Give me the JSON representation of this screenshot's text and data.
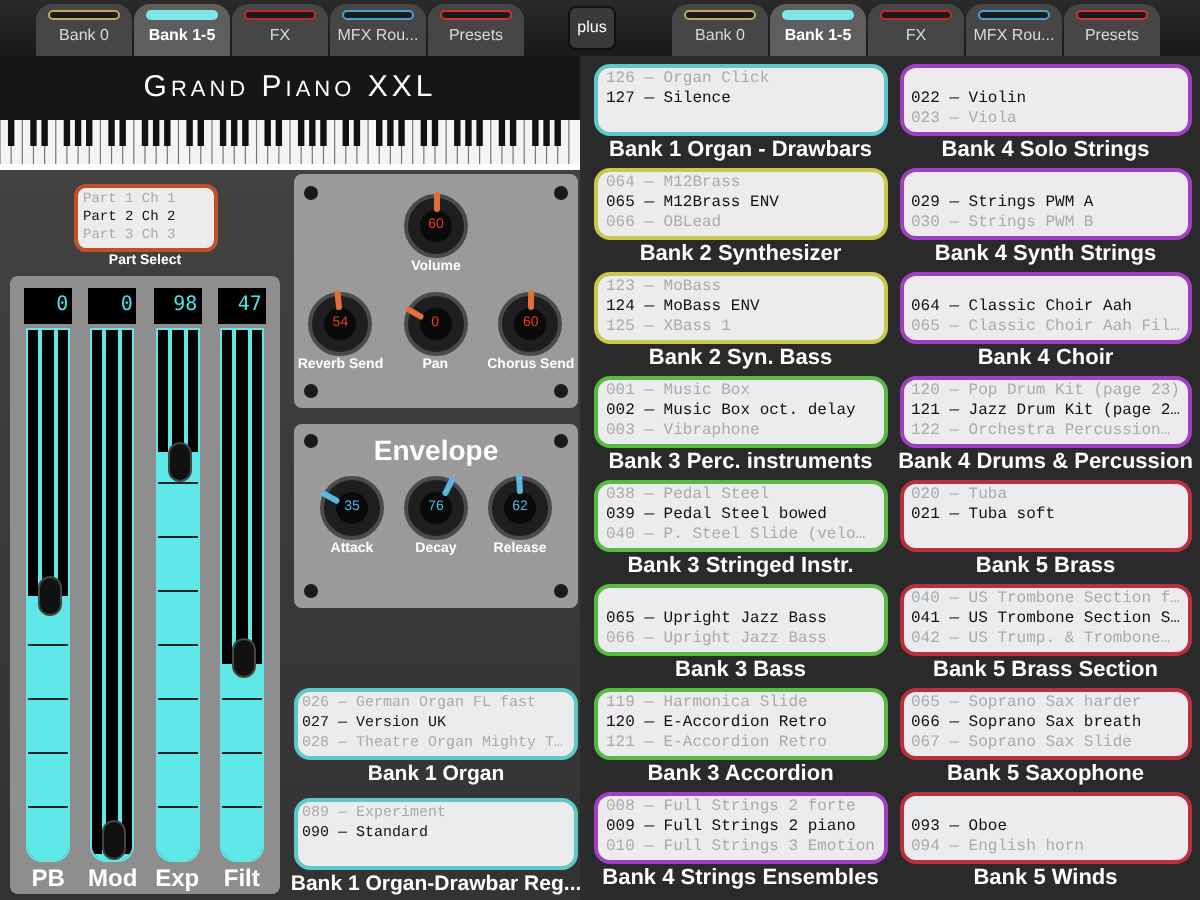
{
  "top_bar": {
    "left_tabs": [
      {
        "label": "Bank 0",
        "selected": false,
        "color": "#c8a860"
      },
      {
        "label": "Bank 1-5",
        "selected": true,
        "color": "#7fe6e6"
      },
      {
        "label": "FX",
        "selected": false,
        "color": "#c0282c"
      },
      {
        "label": "MFX Rou...",
        "selected": false,
        "color": "#4aa0d0"
      },
      {
        "label": "Presets",
        "selected": false,
        "color": "#d03030"
      }
    ],
    "plus_button": "plus",
    "right_tabs": [
      {
        "label": "Bank 0",
        "selected": false,
        "color": "#c8a860"
      },
      {
        "label": "Bank 1-5",
        "selected": true,
        "color": "#7fe6e6"
      },
      {
        "label": "FX",
        "selected": false,
        "color": "#c0282c"
      },
      {
        "label": "MFX Rou...",
        "selected": false,
        "color": "#4aa0d0"
      },
      {
        "label": "Presets",
        "selected": false,
        "color": "#d03030"
      }
    ]
  },
  "instrument": {
    "title": "Grand Piano XXL"
  },
  "part_select": {
    "label": "Part Select",
    "items": [
      {
        "text": "Part 1 Ch 1",
        "selected": false
      },
      {
        "text": "Part 2 Ch 2",
        "selected": true
      },
      {
        "text": "Part 3 Ch 3",
        "selected": false
      }
    ]
  },
  "faders": [
    {
      "label": "PB",
      "value": "0",
      "level": 0.5
    },
    {
      "label": "Mod",
      "value": "0",
      "level": 0
    },
    {
      "label": "Exp",
      "value": "98",
      "level": 0.77
    },
    {
      "label": "Filt",
      "value": "47",
      "level": 0.37
    }
  ],
  "mix_knobs": [
    {
      "label": "Volume",
      "value": "60"
    },
    {
      "label": "Reverb Send",
      "value": "54"
    },
    {
      "label": "Pan",
      "value": "0"
    },
    {
      "label": "Chorus Send",
      "value": "60"
    }
  ],
  "envelope": {
    "title": "Envelope",
    "knobs": [
      {
        "label": "Attack",
        "value": "35"
      },
      {
        "label": "Decay",
        "value": "76"
      },
      {
        "label": "Release",
        "value": "62"
      }
    ]
  },
  "left_banks": [
    {
      "label": "Bank 1 Organ",
      "color": "#5cc8c8",
      "lines": [
        {
          "text": "026 — German Organ FL fast",
          "selected": false
        },
        {
          "text": "027 — Version UK",
          "selected": true
        },
        {
          "text": "028 — Theatre Organ Mighty T…",
          "selected": false
        }
      ]
    },
    {
      "label": "Bank 1 Organ-Drawbar Reg...",
      "color": "#5cc8c8",
      "lines": [
        {
          "text": "089 — Experiment",
          "selected": false
        },
        {
          "text": "090 — Standard",
          "selected": true
        }
      ]
    }
  ],
  "banks": [
    {
      "label": "Bank 1 Organ - Drawbars",
      "color": "#5cc8c8",
      "lines": [
        {
          "text": "126 — Organ Click",
          "selected": false
        },
        {
          "text": "127 — Silence",
          "selected": true
        }
      ]
    },
    {
      "label": "Bank 2 Synthesizer",
      "color": "#c8c84a",
      "lines": [
        {
          "text": "064 — M12Brass",
          "selected": false
        },
        {
          "text": "065 — M12Brass ENV",
          "selected": true
        },
        {
          "text": "066 — OBLead",
          "selected": false
        }
      ]
    },
    {
      "label": "Bank 2 Syn. Bass",
      "color": "#c8c84a",
      "lines": [
        {
          "text": "123 — MoBass",
          "selected": false
        },
        {
          "text": "124 — MoBass ENV",
          "selected": true
        },
        {
          "text": "125 — XBass 1",
          "selected": false
        }
      ]
    },
    {
      "label": "Bank 3 Perc. instruments",
      "color": "#58b848",
      "lines": [
        {
          "text": "001 — Music Box",
          "selected": false
        },
        {
          "text": "002 — Music Box oct. delay",
          "selected": true
        },
        {
          "text": "003 — Vibraphone",
          "selected": false
        }
      ]
    },
    {
      "label": "Bank 3 Stringed Instr.",
      "color": "#58b848",
      "lines": [
        {
          "text": "038 — Pedal Steel",
          "selected": false
        },
        {
          "text": "039 — Pedal Steel bowed",
          "selected": true
        },
        {
          "text": "040 — P. Steel Slide (velo…",
          "selected": false
        }
      ]
    },
    {
      "label": "Bank 3 Bass",
      "color": "#58b848",
      "lines": [
        {
          "text": "065 — Upright Jazz Bass",
          "selected": true
        },
        {
          "text": "066 — Upright Jazz Bass",
          "selected": false
        }
      ]
    },
    {
      "label": "Bank 3 Accordion",
      "color": "#58b848",
      "lines": [
        {
          "text": "119 — Harmonica Slide",
          "selected": false
        },
        {
          "text": "120 — E-Accordion Retro",
          "selected": true
        },
        {
          "text": "121 — E-Accordion Retro",
          "selected": false
        }
      ]
    },
    {
      "label": "Bank 4 Strings Ensembles",
      "color": "#a040c0",
      "lines": [
        {
          "text": "008 — Full Strings 2 forte",
          "selected": false
        },
        {
          "text": "009 — Full Strings 2 piano",
          "selected": true
        },
        {
          "text": "010 — Full Strings 3 Emotion",
          "selected": false
        }
      ]
    },
    {
      "label": "Bank 4 Solo Strings",
      "color": "#a040c0",
      "lines": [
        {
          "text": "022 — Violin",
          "selected": true
        },
        {
          "text": "023 — Viola",
          "selected": false
        }
      ]
    },
    {
      "label": "Bank 4 Synth Strings",
      "color": "#a040c0",
      "lines": [
        {
          "text": "029 — Strings PWM A",
          "selected": true
        },
        {
          "text": "030 — Strings PWM B",
          "selected": false
        }
      ]
    },
    {
      "label": "Bank 4 Choir",
      "color": "#a040c0",
      "lines": [
        {
          "text": "064 — Classic Choir Aah",
          "selected": true
        },
        {
          "text": "065 — Classic Choir Aah Fil…",
          "selected": false
        }
      ]
    },
    {
      "label": "Bank 4 Drums & Percussion",
      "color": "#a040c0",
      "lines": [
        {
          "text": "120 — Pop Drum Kit (page 23)",
          "selected": false
        },
        {
          "text": "121 — Jazz Drum Kit (page 2…",
          "selected": true
        },
        {
          "text": "122 — Orchestra Percussion…",
          "selected": false
        }
      ]
    },
    {
      "label": "Bank 5 Brass",
      "color": "#b83040",
      "lines": [
        {
          "text": "020 — Tuba",
          "selected": false
        },
        {
          "text": "021 — Tuba soft",
          "selected": true
        }
      ]
    },
    {
      "label": "Bank 5 Brass Section",
      "color": "#b83040",
      "lines": [
        {
          "text": "040 — US Trombone Section f…",
          "selected": false
        },
        {
          "text": "041 — US Trombone Section S…",
          "selected": true
        },
        {
          "text": "042 — US Trump. & Trombone…",
          "selected": false
        }
      ]
    },
    {
      "label": "Bank 5 Saxophone",
      "color": "#b83040",
      "lines": [
        {
          "text": "065 — Soprano Sax harder",
          "selected": false
        },
        {
          "text": "066 — Soprano Sax breath",
          "selected": true
        },
        {
          "text": "067 — Soprano Sax Slide",
          "selected": false
        }
      ]
    },
    {
      "label": "Bank 5 Winds",
      "color": "#b83040",
      "lines": [
        {
          "text": "093 — Oboe",
          "selected": true
        },
        {
          "text": "094 — English horn",
          "selected": false
        }
      ]
    }
  ]
}
